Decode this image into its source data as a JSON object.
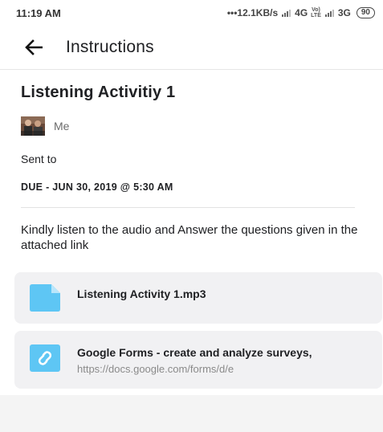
{
  "status_bar": {
    "time": "11:19 AM",
    "net_speed": "•••12.1KB/s",
    "network_1": "4G",
    "volte_top": "Vo)",
    "volte_bottom": "LTE",
    "network_2": "3G",
    "battery": "90"
  },
  "app_bar": {
    "back_icon": "arrow-left",
    "title": "Instructions"
  },
  "assignment": {
    "title": "Listening Activitiy 1",
    "author": "Me",
    "sent_to": "Sent to",
    "due": "DUE - JUN 30, 2019 @ 5:30 AM",
    "instructions": "Kindly listen to the audio and Answer the questions given in the attached link"
  },
  "attachments": [
    {
      "icon": "file-icon",
      "title": "Listening Activity 1.mp3",
      "subtitle": ""
    },
    {
      "icon": "link-icon",
      "title": "Google Forms - create and analyze surveys,",
      "subtitle": "https://docs.google.com/forms/d/e"
    }
  ],
  "colors": {
    "attachment_icon": "#4fc3f7",
    "attachment_bg": "#f1f1f3"
  }
}
